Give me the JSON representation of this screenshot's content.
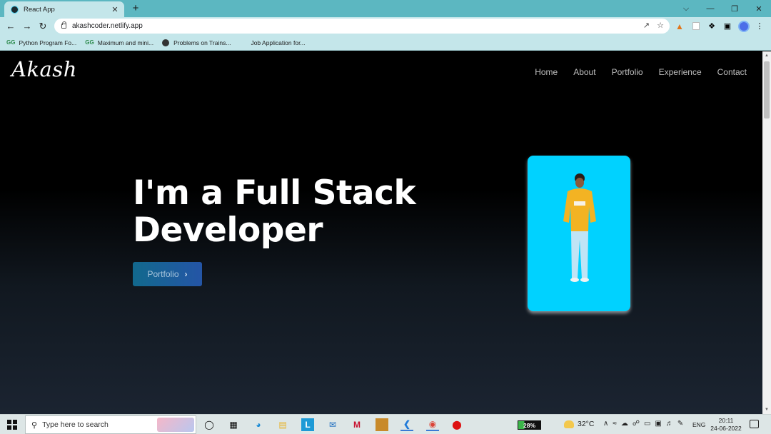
{
  "browser": {
    "tab_title": "React App",
    "tab_close": "✕",
    "new_tab": "+",
    "window_controls": [
      "⌵",
      "—",
      "❐",
      "✕"
    ],
    "url": "akashcoder.netlify.app",
    "bookmarks": [
      {
        "icon": "geeksforgeeks-icon",
        "label": "Python Program Fo..."
      },
      {
        "icon": "geeksforgeeks-icon",
        "label": "Maximum and mini..."
      },
      {
        "icon": "globe-icon",
        "label": "Problems on Trains..."
      },
      {
        "icon": "none",
        "label": "Job Application for..."
      }
    ]
  },
  "site": {
    "logo": "Akash",
    "nav": [
      "Home",
      "About",
      "Portfolio",
      "Experience",
      "Contact"
    ],
    "hero_title": "I'm a Full Stack\nDeveloper",
    "hero_button": "Portfolio",
    "accent_color": "#00d2ff"
  },
  "taskbar": {
    "search_placeholder": "Type here to search",
    "battery": "28%",
    "temperature": "32°C",
    "language": "ENG",
    "time": "20:11",
    "date": "24-06-2022"
  }
}
